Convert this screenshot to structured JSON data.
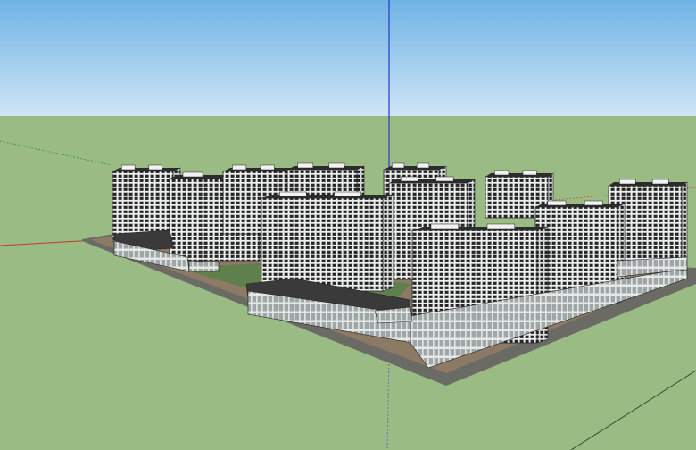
{
  "viewport": {
    "sky_top_color": "#6fb3e6",
    "sky_bottom_color": "#cfe5f5",
    "ground_color": "#9bbb84",
    "axis_colors": {
      "red": "#c0392b",
      "green": "#3f9b4a",
      "blue": "#2b37c9"
    }
  },
  "model": {
    "building_facade_color": "#eef0ef",
    "window_grid_color": "#222222",
    "roof_color": "#2c2c2c",
    "podium_roof_color": "#3a3a3a",
    "site_base_color": "#6b6b66",
    "pavement_color": "#8d7a64",
    "courtyard_green_color": "#5f7f4d"
  }
}
